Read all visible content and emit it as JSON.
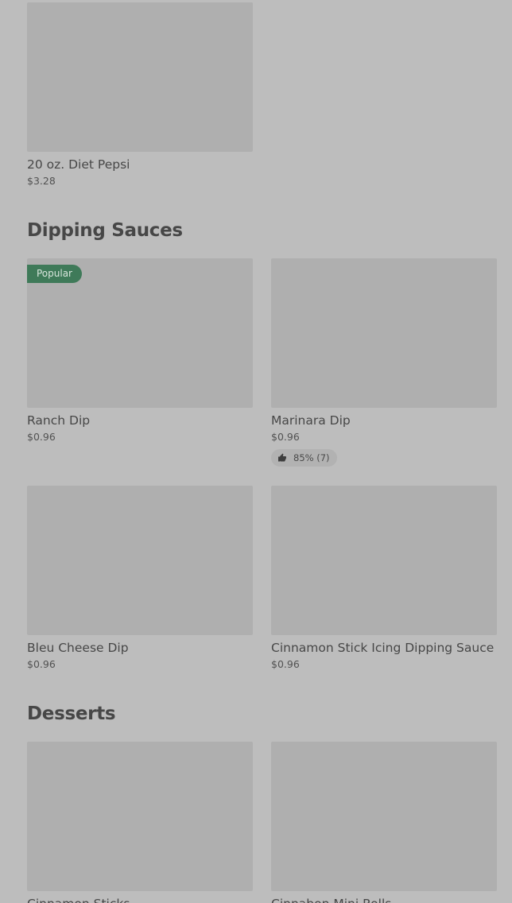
{
  "sections": {
    "drinks": {
      "items": [
        {
          "name": "20 oz. Diet Pepsi",
          "price": "$3.28"
        }
      ]
    },
    "dipping_sauces": {
      "title": "Dipping Sauces",
      "items": [
        {
          "name": "Ranch Dip",
          "price": "$0.96",
          "badge": "Popular"
        },
        {
          "name": "Marinara Dip",
          "price": "$0.96",
          "rating": "85% (7)"
        },
        {
          "name": "Bleu Cheese Dip",
          "price": "$0.96"
        },
        {
          "name": "Cinnamon Stick Icing Dipping Sauce",
          "price": "$0.96"
        }
      ]
    },
    "desserts": {
      "title": "Desserts",
      "items": [
        {
          "name": "Cinnamon Sticks"
        },
        {
          "name": "Cinnabon Mini Rolls"
        }
      ]
    }
  },
  "icons": {
    "rating": "thumbs-up-icon"
  },
  "colors": {
    "background": "#bdbdbd",
    "image_placeholder": "#afafaf",
    "popular_badge": "#3f7a59",
    "text": "#474747"
  }
}
